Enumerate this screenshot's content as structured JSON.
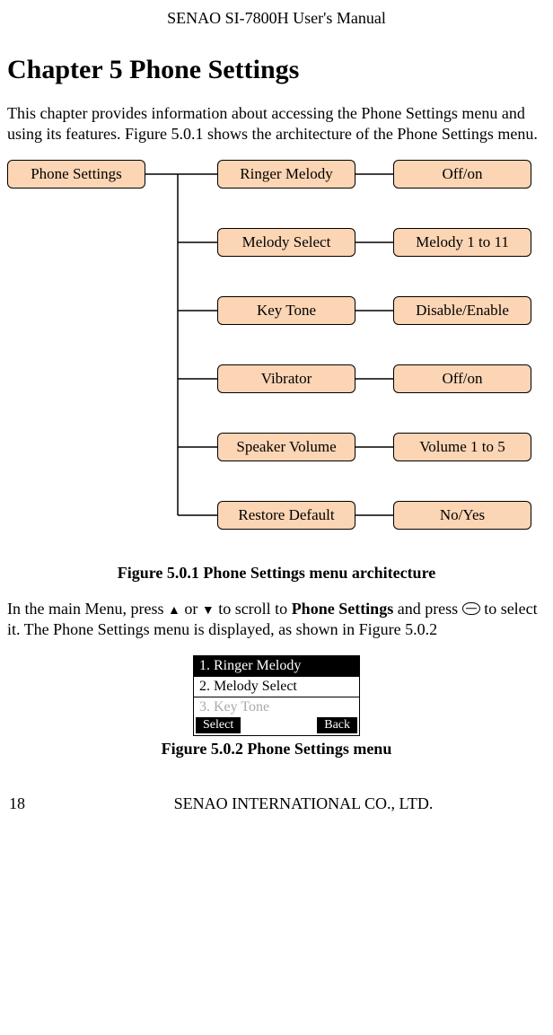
{
  "header": {
    "title": "SENAO SI-7800H User's Manual"
  },
  "chapter": {
    "title": "Chapter 5 Phone Settings"
  },
  "intro": {
    "text": "This chapter provides information about accessing the Phone Settings menu and using its features. Figure 5.0.1 shows the architecture of the Phone Settings menu."
  },
  "diagram": {
    "root": "Phone Settings",
    "rows": [
      {
        "left": "Ringer Melody",
        "right": "Off/on"
      },
      {
        "left": "Melody Select",
        "right": "Melody 1 to 11"
      },
      {
        "left": "Key Tone",
        "right": "Disable/Enable"
      },
      {
        "left": "Vibrator",
        "right": "Off/on"
      },
      {
        "left": "Speaker Volume",
        "right": "Volume 1 to 5"
      },
      {
        "left": "Restore Default",
        "right": "No/Yes"
      }
    ]
  },
  "fig1_caption": "Figure 5.0.1 Phone Settings menu architecture",
  "para2": {
    "pre": "In the main Menu, press ",
    "or": " or ",
    "mid1": " to scroll to ",
    "bold": "Phone Settings",
    "mid2": " and press ",
    "post": " to select it. The Phone Settings menu is displayed, as shown in Figure 5.0.2"
  },
  "phone_menu": {
    "items": [
      {
        "label": "1. Ringer Melody",
        "selected": true,
        "dim": false
      },
      {
        "label": "2. Melody Select",
        "selected": false,
        "dim": false
      },
      {
        "label": "3. Key Tone",
        "selected": false,
        "dim": true
      }
    ],
    "soft_left": "Select",
    "soft_right": "Back"
  },
  "fig2_caption": "Figure 5.0.2 Phone Settings menu",
  "footer": {
    "page": "18",
    "publisher": "SENAO INTERNATIONAL CO., LTD."
  }
}
